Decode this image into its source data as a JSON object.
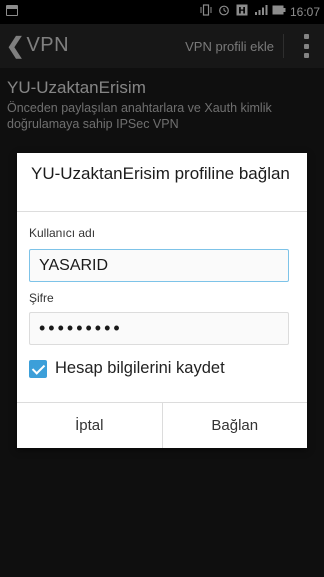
{
  "status_bar": {
    "time": "16:07",
    "icons": [
      "screenshot-icon",
      "vibrate-icon",
      "alarm-icon",
      "h-plus-icon",
      "signal-icon",
      "battery-icon"
    ]
  },
  "action_bar": {
    "back_glyph": "❮",
    "title": "VPN",
    "add_label": "VPN profili ekle"
  },
  "vpn_item": {
    "name": "YU-UzaktanErisim",
    "description": "Önceden paylaşılan anahtarlara ve Xauth kimlik doğrulamaya sahip IPSec VPN"
  },
  "dialog": {
    "title": "YU-UzaktanErisim profiline bağlan",
    "username_label": "Kullanıcı adı",
    "username_value": "YASARID",
    "password_label": "Şifre",
    "password_value": "•••••••••",
    "save_label": "Hesap bilgilerini kaydet",
    "save_checked": true,
    "cancel_label": "İptal",
    "connect_label": "Bağlan"
  },
  "colors": {
    "accent": "#3c9fd9",
    "focus_border": "#7dc3e8"
  }
}
